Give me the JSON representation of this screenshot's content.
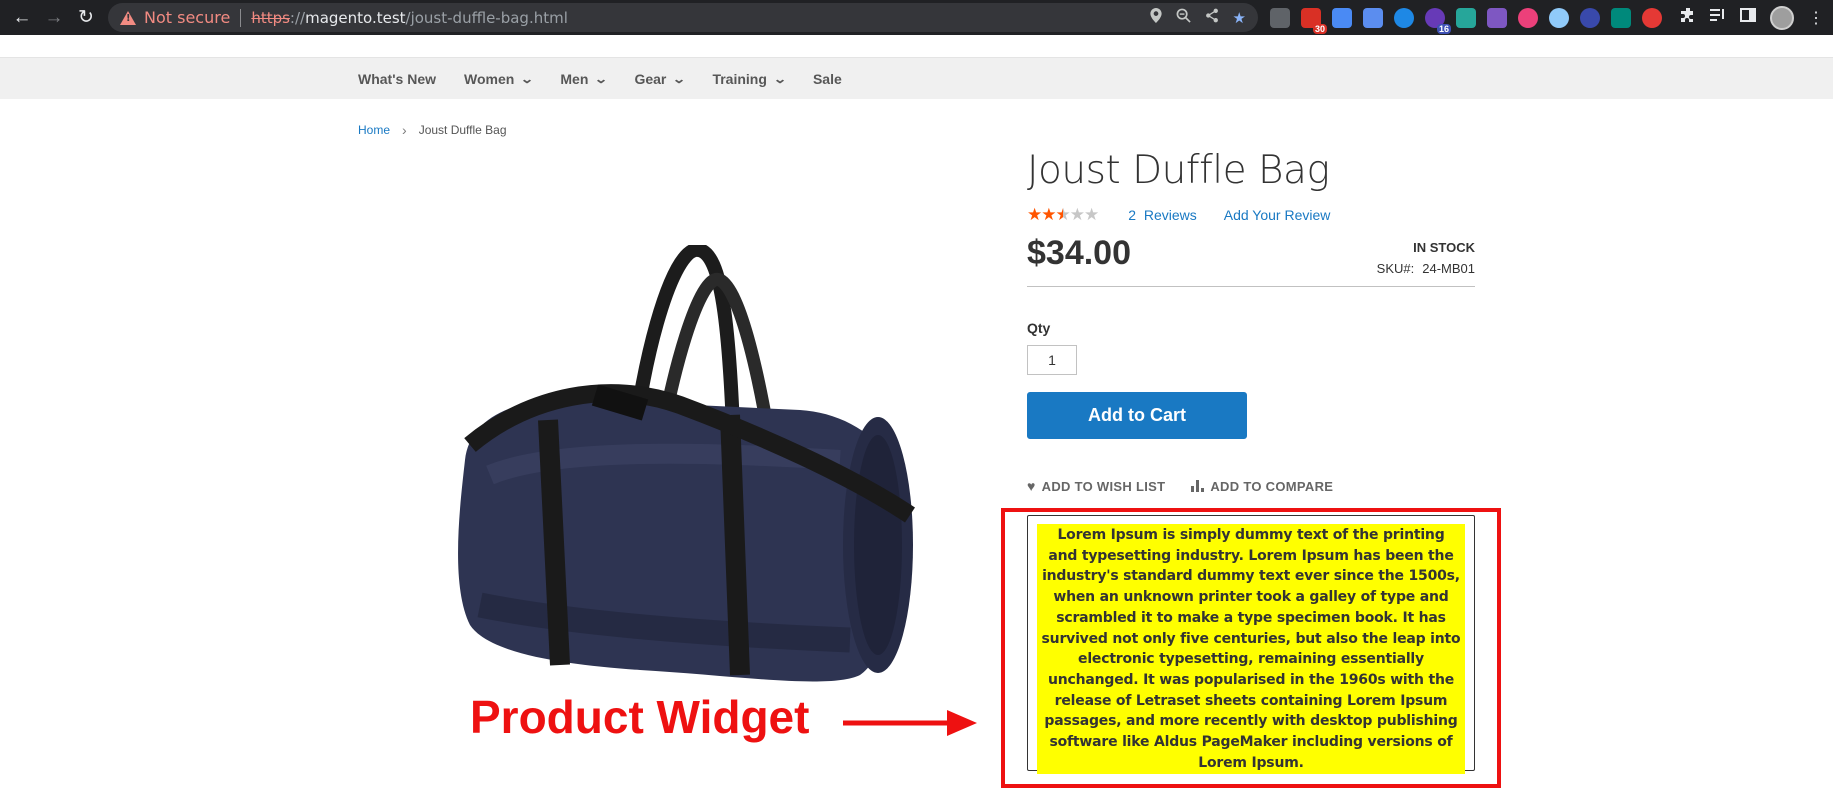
{
  "browser": {
    "security_label": "Not secure",
    "url_scheme": "https",
    "url_scheme_rest": "://",
    "url_host": "magento.test",
    "url_path": "/joust-duffle-bag.html",
    "extension_badges": {
      "mail": "30",
      "app": "16"
    }
  },
  "nav": {
    "items": [
      {
        "label": "What's New",
        "has_dropdown": false
      },
      {
        "label": "Women",
        "has_dropdown": true
      },
      {
        "label": "Men",
        "has_dropdown": true
      },
      {
        "label": "Gear",
        "has_dropdown": true
      },
      {
        "label": "Training",
        "has_dropdown": true
      },
      {
        "label": "Sale",
        "has_dropdown": false
      }
    ]
  },
  "breadcrumb": {
    "home": "Home",
    "separator": "›",
    "current": "Joust Duffle Bag"
  },
  "product": {
    "title": "Joust Duffle Bag",
    "rating_fraction": 0.5,
    "reviews_count": "2",
    "reviews_label": "Reviews",
    "add_review_label": "Add Your Review",
    "price": "$34.00",
    "stock": "IN STOCK",
    "sku_label": "SKU#:",
    "sku_value": "24-MB01",
    "qty_label": "Qty",
    "qty_value": "1",
    "add_to_cart_label": "Add to Cart",
    "wishlist_label": "ADD TO WISH LIST",
    "compare_label": "ADD TO COMPARE"
  },
  "widget": {
    "text": "Lorem Ipsum is simply dummy text of the printing and typesetting industry. Lorem Ipsum has been the industry's standard dummy text ever since the 1500s, when an unknown printer took a galley of type and scrambled it to make a type specimen book. It has survived not only five centuries, but also the leap into electronic typesetting, remaining essentially unchanged. It was popularised in the 1960s with the release of Letraset sheets containing Lorem Ipsum passages, and more recently with desktop publishing software like Aldus PageMaker including versions of Lorem Ipsum.",
    "annotation_label": "Product Widget"
  },
  "colors": {
    "accent": "#1979c3",
    "star": "#ff5501",
    "annotation": "#ee1111",
    "highlight": "#ffff00"
  }
}
